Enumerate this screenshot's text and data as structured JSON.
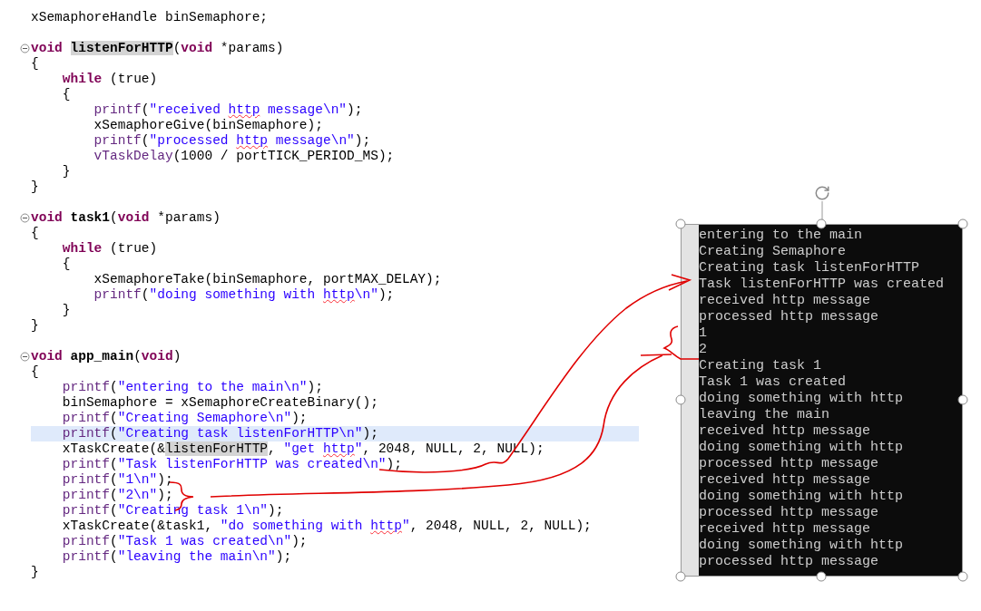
{
  "editor": {
    "lines": [
      {
        "kind": "code",
        "fold": false,
        "current": false,
        "tokens": [
          {
            "kind": "plain",
            "text": "xSemaphoreHandle binSemaphore;"
          }
        ]
      },
      {
        "kind": "blank"
      },
      {
        "kind": "code",
        "fold": true,
        "current": false,
        "tokens": [
          {
            "kind": "keyword",
            "text": "void "
          },
          {
            "kind": "declaration-occurrence",
            "text": "listenForHTTP"
          },
          {
            "kind": "plain",
            "text": "("
          },
          {
            "kind": "keyword",
            "text": "void"
          },
          {
            "kind": "plain",
            "text": " *params)"
          }
        ]
      },
      {
        "kind": "code",
        "fold": false,
        "current": false,
        "tokens": [
          {
            "kind": "plain",
            "text": "{"
          }
        ]
      },
      {
        "kind": "code",
        "fold": false,
        "current": false,
        "tokens": [
          {
            "kind": "keyword",
            "text": "    while"
          },
          {
            "kind": "plain",
            "text": " (true)"
          }
        ]
      },
      {
        "kind": "code",
        "fold": false,
        "current": false,
        "tokens": [
          {
            "kind": "plain",
            "text": "    {"
          }
        ]
      },
      {
        "kind": "code",
        "fold": false,
        "current": false,
        "tokens": [
          {
            "kind": "function",
            "text": "        printf"
          },
          {
            "kind": "plain",
            "text": "("
          },
          {
            "kind": "string",
            "text": "\"received "
          },
          {
            "kind": "string-misspelled",
            "text": "http"
          },
          {
            "kind": "string",
            "text": " message\\n\""
          },
          {
            "kind": "plain",
            "text": ");"
          }
        ]
      },
      {
        "kind": "code",
        "fold": false,
        "current": false,
        "tokens": [
          {
            "kind": "plain",
            "text": "        xSemaphoreGive(binSemaphore);"
          }
        ]
      },
      {
        "kind": "code",
        "fold": false,
        "current": false,
        "tokens": [
          {
            "kind": "function",
            "text": "        printf"
          },
          {
            "kind": "plain",
            "text": "("
          },
          {
            "kind": "string",
            "text": "\"processed "
          },
          {
            "kind": "string-misspelled",
            "text": "http"
          },
          {
            "kind": "string",
            "text": " message\\n\""
          },
          {
            "kind": "plain",
            "text": ");"
          }
        ]
      },
      {
        "kind": "code",
        "fold": false,
        "current": false,
        "tokens": [
          {
            "kind": "function",
            "text": "        vTaskDelay"
          },
          {
            "kind": "plain",
            "text": "(1000 / portTICK_PERIOD_MS);"
          }
        ]
      },
      {
        "kind": "code",
        "fold": false,
        "current": false,
        "tokens": [
          {
            "kind": "plain",
            "text": "    }"
          }
        ]
      },
      {
        "kind": "code",
        "fold": false,
        "current": false,
        "tokens": [
          {
            "kind": "plain",
            "text": "}"
          }
        ]
      },
      {
        "kind": "blank"
      },
      {
        "kind": "code",
        "fold": true,
        "current": false,
        "tokens": [
          {
            "kind": "keyword",
            "text": "void "
          },
          {
            "kind": "declaration",
            "text": "task1"
          },
          {
            "kind": "plain",
            "text": "("
          },
          {
            "kind": "keyword",
            "text": "void"
          },
          {
            "kind": "plain",
            "text": " *params)"
          }
        ]
      },
      {
        "kind": "code",
        "fold": false,
        "current": false,
        "tokens": [
          {
            "kind": "plain",
            "text": "{"
          }
        ]
      },
      {
        "kind": "code",
        "fold": false,
        "current": false,
        "tokens": [
          {
            "kind": "keyword",
            "text": "    while"
          },
          {
            "kind": "plain",
            "text": " (true)"
          }
        ]
      },
      {
        "kind": "code",
        "fold": false,
        "current": false,
        "tokens": [
          {
            "kind": "plain",
            "text": "    {"
          }
        ]
      },
      {
        "kind": "code",
        "fold": false,
        "current": false,
        "tokens": [
          {
            "kind": "plain",
            "text": "        xSemaphoreTake(binSemaphore, portMAX_DELAY);"
          }
        ]
      },
      {
        "kind": "code",
        "fold": false,
        "current": false,
        "tokens": [
          {
            "kind": "function",
            "text": "        printf"
          },
          {
            "kind": "plain",
            "text": "("
          },
          {
            "kind": "string",
            "text": "\"doing something with "
          },
          {
            "kind": "string-misspelled",
            "text": "http"
          },
          {
            "kind": "string",
            "text": "\\n\""
          },
          {
            "kind": "plain",
            "text": ");"
          }
        ]
      },
      {
        "kind": "code",
        "fold": false,
        "current": false,
        "tokens": [
          {
            "kind": "plain",
            "text": "    }"
          }
        ]
      },
      {
        "kind": "code",
        "fold": false,
        "current": false,
        "tokens": [
          {
            "kind": "plain",
            "text": "}"
          }
        ]
      },
      {
        "kind": "blank"
      },
      {
        "kind": "code",
        "fold": true,
        "current": false,
        "tokens": [
          {
            "kind": "keyword",
            "text": "void "
          },
          {
            "kind": "declaration",
            "text": "app_main"
          },
          {
            "kind": "plain",
            "text": "("
          },
          {
            "kind": "keyword",
            "text": "void"
          },
          {
            "kind": "plain",
            "text": ")"
          }
        ]
      },
      {
        "kind": "code",
        "fold": false,
        "current": false,
        "tokens": [
          {
            "kind": "plain",
            "text": "{"
          }
        ]
      },
      {
        "kind": "code",
        "fold": false,
        "current": false,
        "tokens": [
          {
            "kind": "function",
            "text": "    printf"
          },
          {
            "kind": "plain",
            "text": "("
          },
          {
            "kind": "string",
            "text": "\"entering to the main\\n\""
          },
          {
            "kind": "plain",
            "text": ");"
          }
        ]
      },
      {
        "kind": "code",
        "fold": false,
        "current": false,
        "tokens": [
          {
            "kind": "plain",
            "text": "    binSemaphore = xSemaphoreCreateBinary();"
          }
        ]
      },
      {
        "kind": "code",
        "fold": false,
        "current": false,
        "tokens": [
          {
            "kind": "function",
            "text": "    printf"
          },
          {
            "kind": "plain",
            "text": "("
          },
          {
            "kind": "string",
            "text": "\"Creating Semaphore\\n\""
          },
          {
            "kind": "plain",
            "text": ");"
          }
        ]
      },
      {
        "kind": "code",
        "fold": false,
        "current": true,
        "tokens": [
          {
            "kind": "function",
            "text": "    printf"
          },
          {
            "kind": "plain",
            "text": "("
          },
          {
            "kind": "string",
            "text": "\"Creating task listenForHTTP\\n\""
          },
          {
            "kind": "plain",
            "text": ");"
          }
        ]
      },
      {
        "kind": "code",
        "fold": false,
        "current": false,
        "tokens": [
          {
            "kind": "plain",
            "text": "    xTaskCreate(&"
          },
          {
            "kind": "occurrence",
            "text": "listenForHTTP"
          },
          {
            "kind": "plain",
            "text": ", "
          },
          {
            "kind": "string",
            "text": "\"get "
          },
          {
            "kind": "string-misspelled",
            "text": "http"
          },
          {
            "kind": "string",
            "text": "\""
          },
          {
            "kind": "plain",
            "text": ", 2048, NULL, 2, NULL);"
          }
        ]
      },
      {
        "kind": "code",
        "fold": false,
        "current": false,
        "tokens": [
          {
            "kind": "function",
            "text": "    printf"
          },
          {
            "kind": "plain",
            "text": "("
          },
          {
            "kind": "string",
            "text": "\"Task listenForHTTP was created\\n\""
          },
          {
            "kind": "plain",
            "text": ");"
          }
        ]
      },
      {
        "kind": "code",
        "fold": false,
        "current": false,
        "tokens": [
          {
            "kind": "function",
            "text": "    printf"
          },
          {
            "kind": "plain",
            "text": "("
          },
          {
            "kind": "string",
            "text": "\"1\\n\""
          },
          {
            "kind": "plain",
            "text": ");"
          }
        ]
      },
      {
        "kind": "code",
        "fold": false,
        "current": false,
        "tokens": [
          {
            "kind": "function",
            "text": "    printf"
          },
          {
            "kind": "plain",
            "text": "("
          },
          {
            "kind": "string",
            "text": "\"2\\n\""
          },
          {
            "kind": "plain",
            "text": ");"
          }
        ]
      },
      {
        "kind": "code",
        "fold": false,
        "current": false,
        "tokens": [
          {
            "kind": "function",
            "text": "    printf"
          },
          {
            "kind": "plain",
            "text": "("
          },
          {
            "kind": "string",
            "text": "\"Creating task 1\\n\""
          },
          {
            "kind": "plain",
            "text": ");"
          }
        ]
      },
      {
        "kind": "code",
        "fold": false,
        "current": false,
        "tokens": [
          {
            "kind": "plain",
            "text": "    xTaskCreate(&task1, "
          },
          {
            "kind": "string",
            "text": "\"do something with "
          },
          {
            "kind": "string-misspelled",
            "text": "http"
          },
          {
            "kind": "string",
            "text": "\""
          },
          {
            "kind": "plain",
            "text": ", 2048, NULL, 2, NULL);"
          }
        ]
      },
      {
        "kind": "code",
        "fold": false,
        "current": false,
        "tokens": [
          {
            "kind": "function",
            "text": "    printf"
          },
          {
            "kind": "plain",
            "text": "("
          },
          {
            "kind": "string",
            "text": "\"Task 1 was created\\n\""
          },
          {
            "kind": "plain",
            "text": ");"
          }
        ]
      },
      {
        "kind": "code",
        "fold": false,
        "current": false,
        "tokens": [
          {
            "kind": "function",
            "text": "    printf"
          },
          {
            "kind": "plain",
            "text": "("
          },
          {
            "kind": "string",
            "text": "\"leaving the main\\n\""
          },
          {
            "kind": "plain",
            "text": ");"
          }
        ]
      },
      {
        "kind": "code",
        "fold": false,
        "current": false,
        "tokens": [
          {
            "kind": "plain",
            "text": "}"
          }
        ]
      }
    ]
  },
  "terminal_image": {
    "lines": [
      "entering to the main",
      "Creating Semaphore",
      "Creating task listenForHTTP",
      "Task listenForHTTP was created",
      "received http message",
      "processed http message",
      "1",
      "2",
      "Creating task 1",
      "Task 1 was created",
      "doing something with http",
      "leaving the main",
      "received http message",
      "doing something with http",
      "processed http message",
      "received http message",
      "doing something with http",
      "processed http message",
      "received http message",
      "doing something with http",
      "processed http message"
    ]
  }
}
